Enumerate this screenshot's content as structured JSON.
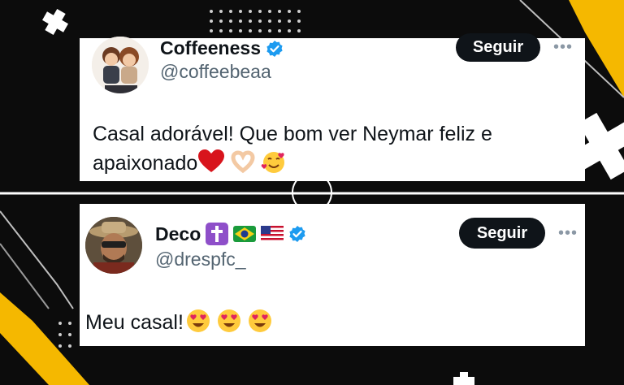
{
  "colors": {
    "accent_yellow": "#f5b800",
    "verified_blue": "#1d9bf0",
    "card_bg": "#ffffff",
    "page_bg": "#0c0c0c",
    "button_bg": "#0f1419"
  },
  "posts": [
    {
      "display_name": "Coffeeness",
      "handle": "@coffeebeaa",
      "verified": true,
      "follow_label": "Seguir",
      "more_label": "•••",
      "text_line1": "Casal adorável! Que bom ver Neymar feliz e",
      "text_line2": "apaixonado",
      "emojis": [
        "heart-emoji",
        "heart-hands-emoji",
        "smiling-face-with-hearts-emoji"
      ]
    },
    {
      "display_name": "Deco",
      "handle": "@drespfc_",
      "verified": true,
      "follow_label": "Seguir",
      "more_label": "•••",
      "text": "Meu casal!",
      "name_icons": [
        "latin-cross-icon",
        "brazil-flag-icon",
        "usa-flag-icon"
      ],
      "emojis": [
        "heart-eyes-emoji",
        "heart-eyes-emoji",
        "heart-eyes-emoji"
      ]
    }
  ]
}
